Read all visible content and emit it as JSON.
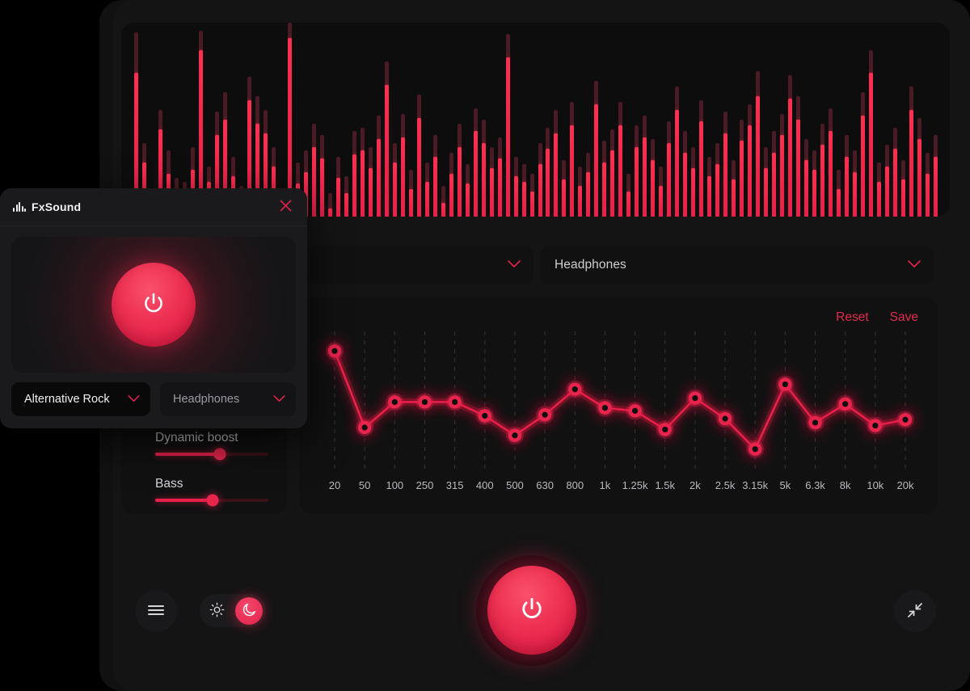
{
  "app": {
    "name": "FxSound",
    "accent": "#e8204a",
    "accent_bright": "#f5476a",
    "background": "#141415",
    "panel": "#111112"
  },
  "overlay_window": {
    "title": "FxSound",
    "logo_icon": "equalizer-bars-icon",
    "close_icon": "close-icon",
    "power_icon": "power-icon",
    "preset_dropdown": {
      "value": "Alternative Rock",
      "chevron_icon": "chevron-down-icon"
    },
    "output_dropdown": {
      "value": "Headphones",
      "chevron_icon": "chevron-down-icon"
    }
  },
  "main_window": {
    "preset_dropdown": {
      "value": "",
      "chevron_icon": "chevron-down-icon"
    },
    "output_dropdown": {
      "value": "Headphones",
      "chevron_icon": "chevron-down-icon"
    },
    "equalizer": {
      "reset_label": "Reset",
      "save_label": "Save"
    },
    "effects": {
      "sliders": [
        {
          "label": "Dynamic boost",
          "value": 57
        },
        {
          "label": "Bass",
          "value": 51
        }
      ]
    },
    "toolbar": {
      "menu_icon": "hamburger-menu-icon",
      "light_theme_icon": "sun-icon",
      "dark_theme_icon": "moon-icon",
      "active_theme": "dark",
      "collapse_icon": "collapse-arrows-icon"
    },
    "power_icon": "power-icon"
  },
  "chart_data": [
    {
      "type": "line",
      "name": "equalizer-curve",
      "title": "",
      "xlabel": "",
      "ylabel": "",
      "grid": true,
      "legend": "none",
      "categories": [
        "20",
        "50",
        "100",
        "250",
        "315",
        "400",
        "500",
        "630",
        "800",
        "1k",
        "1.25k",
        "1.5k",
        "2k",
        "2.5k",
        "3.15k",
        "5k",
        "6.3k",
        "8k",
        "10k",
        "20k"
      ],
      "values": [
        6.0,
        -1.8,
        0.8,
        0.8,
        0.8,
        -0.6,
        -2.6,
        -0.5,
        2.1,
        0.2,
        -0.1,
        -2.0,
        1.2,
        -0.9,
        -4.0,
        2.6,
        -1.3,
        0.6,
        -1.6,
        -1.0
      ],
      "ylim": [
        -6,
        8
      ]
    },
    {
      "type": "bar",
      "name": "spectrum-visualizer",
      "title": "",
      "xlabel": "",
      "ylabel": "",
      "grid": false,
      "legend": "none",
      "ylim": [
        0,
        100
      ],
      "series": [
        {
          "name": "level",
          "values": [
            74,
            28,
            8,
            45,
            22,
            13,
            10,
            24,
            86,
            18,
            42,
            50,
            21,
            8,
            60,
            48,
            43,
            26,
            4,
            92,
            17,
            23,
            36,
            30,
            4,
            20,
            12,
            32,
            34,
            25,
            40,
            68,
            28,
            41,
            14,
            51,
            18,
            31,
            7,
            22,
            36,
            17,
            44,
            38,
            25,
            30,
            82,
            21,
            18,
            13,
            27,
            35,
            43,
            19,
            47,
            16,
            23,
            58,
            28,
            34,
            47,
            13,
            36,
            41,
            29,
            16,
            38,
            55,
            33,
            25,
            49,
            21,
            27,
            43,
            19,
            39,
            47,
            62,
            25,
            33,
            42,
            61,
            50,
            29,
            24,
            37,
            44,
            14,
            31,
            23,
            52,
            74,
            18,
            26,
            35,
            19,
            55,
            40,
            22,
            31
          ]
        },
        {
          "name": "peak",
          "values": [
            95,
            38,
            14,
            55,
            34,
            20,
            18,
            36,
            96,
            26,
            54,
            64,
            31,
            16,
            72,
            62,
            55,
            36,
            12,
            100,
            28,
            34,
            48,
            42,
            12,
            31,
            21,
            44,
            46,
            36,
            52,
            80,
            38,
            53,
            24,
            63,
            28,
            42,
            16,
            33,
            48,
            27,
            56,
            50,
            36,
            41,
            94,
            31,
            27,
            22,
            38,
            46,
            55,
            29,
            59,
            26,
            33,
            70,
            39,
            45,
            59,
            22,
            47,
            52,
            40,
            26,
            49,
            67,
            44,
            36,
            60,
            31,
            38,
            54,
            29,
            50,
            58,
            75,
            36,
            44,
            53,
            73,
            62,
            40,
            34,
            48,
            56,
            24,
            42,
            34,
            64,
            86,
            28,
            37,
            46,
            29,
            67,
            51,
            33,
            42
          ]
        }
      ]
    }
  ]
}
